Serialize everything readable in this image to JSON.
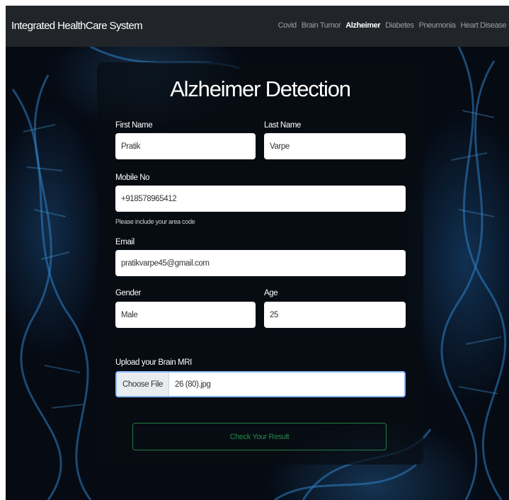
{
  "navbar": {
    "brand": "Integrated HealthCare System",
    "links": [
      "Covid",
      "Brain Tumor",
      "Alzheimer",
      "Diabetes",
      "Pneumonia",
      "Heart Disease"
    ],
    "active": "Alzheimer"
  },
  "form": {
    "title": "Alzheimer Detection",
    "first_name": {
      "label": "First Name",
      "value": "Pratik"
    },
    "last_name": {
      "label": "Last Name",
      "value": "Varpe"
    },
    "mobile": {
      "label": "Mobile No",
      "value": "+918578965412",
      "help": "Please include your area code"
    },
    "email": {
      "label": "Email",
      "value": "pratikvarpe45@gmail.com"
    },
    "gender": {
      "label": "Gender",
      "value": "Male"
    },
    "age": {
      "label": "Age",
      "value": "25"
    },
    "upload": {
      "label": "Upload your Brain MRI",
      "button": "Choose File",
      "filename": "26 (80).jpg"
    },
    "submit": "Check Your Result"
  },
  "colors": {
    "navbar_bg": "#212529",
    "submit_border": "#1e7f3f",
    "submit_text": "#1f8a46",
    "background": "#050a13"
  }
}
